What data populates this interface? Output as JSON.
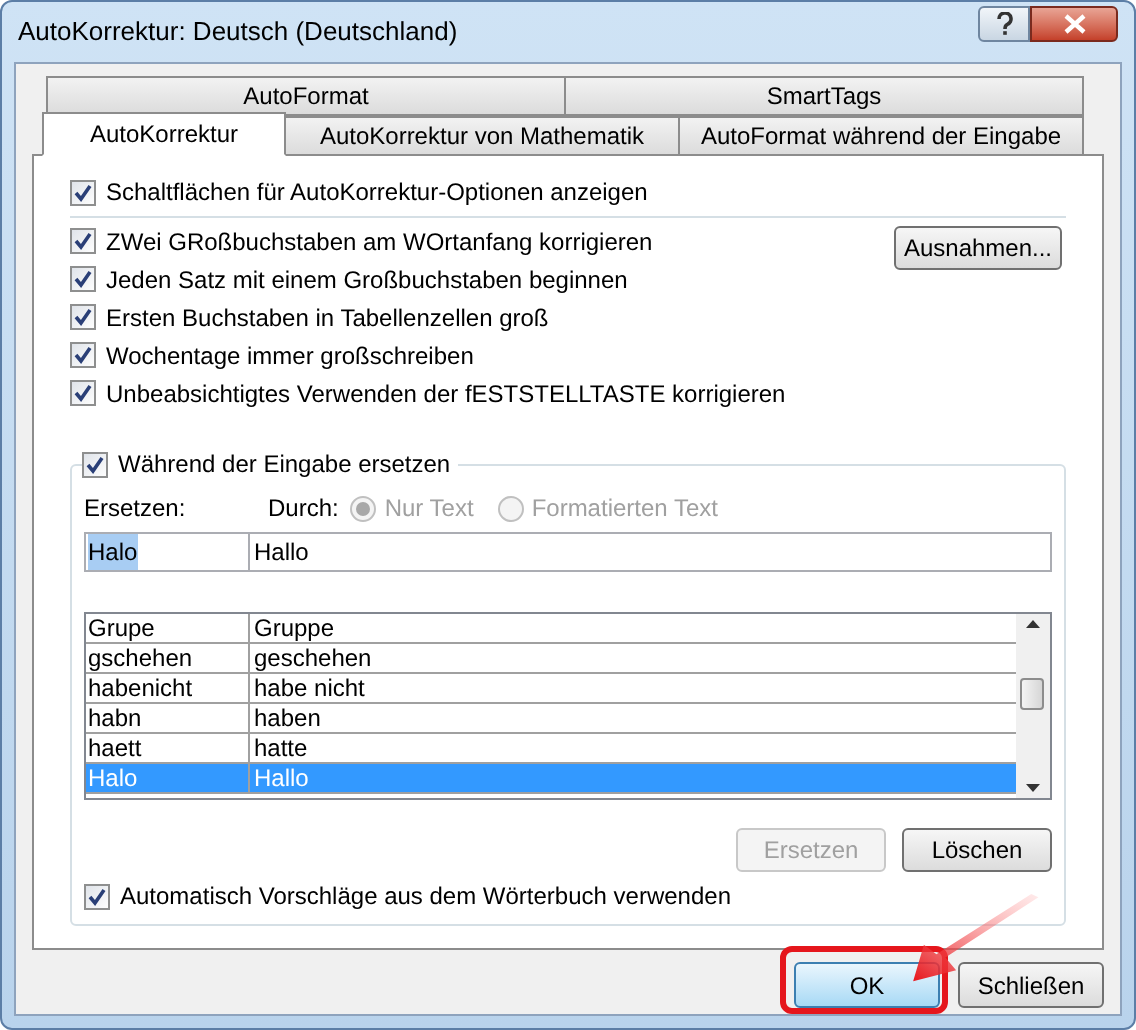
{
  "window": {
    "title": "AutoKorrektur: Deutsch (Deutschland)"
  },
  "tab_rows": [
    [
      {
        "label": "AutoFormat",
        "selected": false
      },
      {
        "label": "SmartTags",
        "selected": false
      }
    ],
    [
      {
        "label": "AutoKorrektur",
        "selected": true
      },
      {
        "label": "AutoKorrektur von Mathematik",
        "selected": false
      },
      {
        "label": "AutoFormat während der Eingabe",
        "selected": false
      }
    ]
  ],
  "show_buttons": {
    "label": "Schaltflächen für AutoKorrektur-Optionen anzeigen",
    "checked": true
  },
  "options": [
    {
      "label": "ZWei GRoßbuchstaben am WOrtanfang korrigieren",
      "checked": true
    },
    {
      "label": "Jeden Satz mit einem Großbuchstaben beginnen",
      "checked": true
    },
    {
      "label": "Ersten Buchstaben in Tabellenzellen groß",
      "checked": true
    },
    {
      "label": "Wochentage immer großschreiben",
      "checked": true
    },
    {
      "label": "Unbeabsichtigtes Verwenden der fESTSTELLTASTE korrigieren",
      "checked": true
    }
  ],
  "exceptions_button": "Ausnahmen...",
  "replace_group": {
    "label": "Während der Eingabe ersetzen",
    "checked": true,
    "replace_label": "Ersetzen:",
    "with_label": "Durch:",
    "radios": [
      {
        "label": "Nur Text",
        "selected": true,
        "disabled": true
      },
      {
        "label": "Formatierten Text",
        "selected": false,
        "disabled": true
      }
    ],
    "replace_value": "Halo",
    "with_value": "Hallo",
    "rows": [
      {
        "from": "Grupe",
        "to": "Gruppe",
        "selected": false
      },
      {
        "from": "gschehen",
        "to": "geschehen",
        "selected": false
      },
      {
        "from": "habenicht",
        "to": "habe nicht",
        "selected": false
      },
      {
        "from": "habn",
        "to": "haben",
        "selected": false
      },
      {
        "from": "haett",
        "to": "hatte",
        "selected": false
      },
      {
        "from": "Halo",
        "to": "Hallo",
        "selected": true
      }
    ],
    "buttons": [
      {
        "label": "Ersetzen",
        "disabled": true
      },
      {
        "label": "Löschen",
        "disabled": false
      }
    ],
    "suggestions": {
      "label": "Automatisch Vorschläge aus dem Wörterbuch verwenden",
      "checked": true
    }
  },
  "footer_buttons": [
    {
      "label": "OK",
      "default": true
    },
    {
      "label": "Schließen",
      "default": false
    }
  ]
}
